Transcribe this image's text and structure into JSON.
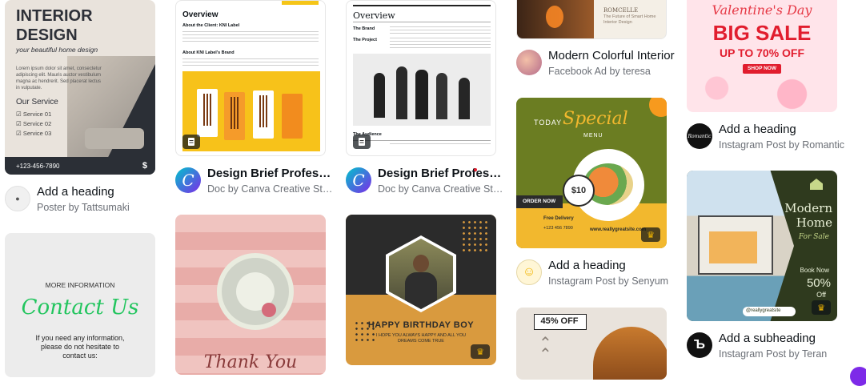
{
  "colors": {
    "canva_blue": "#7d2ae8",
    "title_text": "#0e1318",
    "subtitle_text": "#6b6f76"
  },
  "col1": {
    "card1": {
      "headline1": "INTERIOR",
      "headline2": "DESIGN",
      "tagline": "your beautiful home design",
      "body": "Lorem ipsum dolor sit amet, consectetur adipiscing elit. Mauris auctor vestibulum magna ac hendrerit. Sed placerat lectus in vulputate.",
      "service_heading": "Our Service",
      "services": [
        "Service 01",
        "Service 02",
        "Service 03"
      ],
      "phone": "+123-456-7890",
      "price_icon": "dollar-icon"
    },
    "card1_meta": {
      "title": "Add a heading",
      "subtitle": "Poster by Tattsumaki"
    },
    "card2": {
      "more_info": "MORE INFORMATION",
      "title": "Contact Us",
      "body": "If you need any information, please do not hesitate to contact us:"
    }
  },
  "col2": {
    "card1": {
      "section": "Overview",
      "sub1": "About the Client: KNI Label",
      "sub2": "About KNI Label's Brand",
      "doc_icon": "document-icon"
    },
    "card1_meta": {
      "title": "Design Brief Professional",
      "subtitle": "Doc by Canva Creative Studio",
      "avatar_letter": "C"
    },
    "card2": {
      "text": "Thank You"
    }
  },
  "col3": {
    "card1": {
      "section": "Overview",
      "rows": [
        {
          "label": "The Brand"
        },
        {
          "label": "The Project"
        }
      ],
      "audience": "The Audience",
      "doc_icon": "document-icon"
    },
    "card1_meta": {
      "title": "Design Brief Professional",
      "subtitle": "Doc by Canva Creative Studio",
      "avatar_letter": "C"
    },
    "card2": {
      "title": "HAPPY BIRTHDAY BOY",
      "message": "I HOPE YOU ALWAYS HAPPY AND ALL YOU DREAMS COME TRUE",
      "crown_icon": "crown-icon"
    }
  },
  "col4": {
    "card1": {
      "brand": "ROMCELLE",
      "tagline": "The Future of Smart Home Interior Design"
    },
    "card1_meta": {
      "title": "Modern Colorful Interior",
      "subtitle": "Facebook Ad by teresa"
    },
    "card2": {
      "today": "TODAY",
      "special": "Special",
      "menu": "MENU",
      "price": "$10",
      "order": "ORDER NOW",
      "delivery": "Free Delivery",
      "phone": "+123 456 7890",
      "website": "www.reallygreatsite.com",
      "crown_icon": "crown-icon"
    },
    "card2_meta": {
      "title": "Add a heading",
      "subtitle": "Instagram Post by Senyum"
    },
    "card3": {
      "discount": "45% OFF"
    }
  },
  "col5": {
    "card1": {
      "occasion": "Valentine's Day",
      "headline": "BIG SALE",
      "offer": "UP TO 70% OFF",
      "cta": "SHOP NOW"
    },
    "card1_meta": {
      "title": "Add a heading",
      "subtitle": "Instagram Post by Romantic",
      "avatar_text": "Romantic"
    },
    "card2": {
      "title1": "Modern",
      "title2": "Home",
      "for_sale": "For Sale",
      "book": "Book Now",
      "discount": "50%",
      "off": "Off",
      "handle": "@reallygreatsite",
      "crown_icon": "crown-icon"
    },
    "card2_meta": {
      "title": "Add a subheading",
      "subtitle": "Instagram Post by Teran",
      "avatar_letter": "Ъ"
    }
  }
}
